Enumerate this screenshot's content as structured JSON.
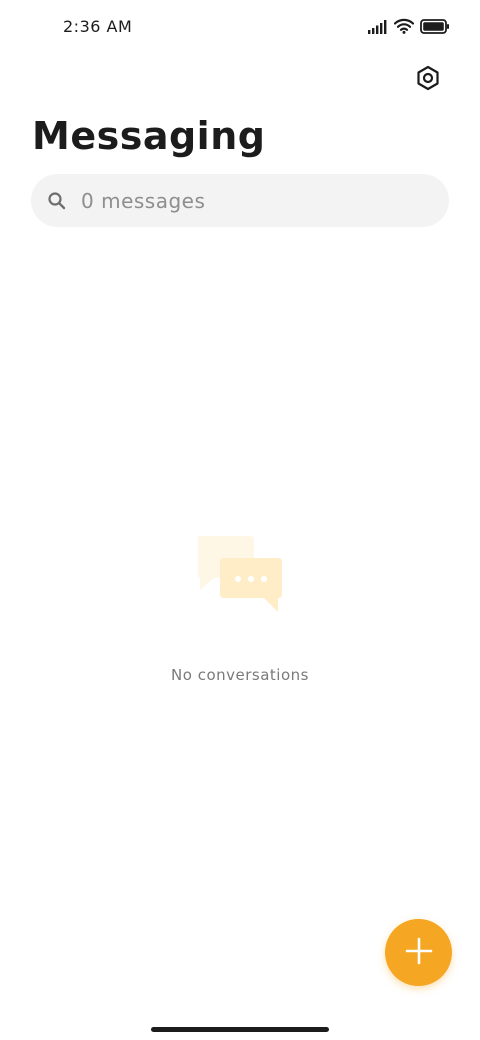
{
  "status_bar": {
    "time": "2:36 AM",
    "icons": [
      "signal-icon",
      "wifi-icon",
      "battery-icon"
    ]
  },
  "header": {
    "settings_icon": "settings-icon",
    "title": "Messaging"
  },
  "search": {
    "icon": "search-icon",
    "placeholder": "0 messages"
  },
  "empty_state": {
    "icon": "chat-bubbles-icon",
    "text": "No conversations"
  },
  "fab": {
    "icon": "plus-icon"
  },
  "colors": {
    "accent": "#f5a623",
    "illustration_light": "#fff7e6",
    "illustration_mid": "#ffedc7",
    "text_primary": "#1c1c1c",
    "text_secondary": "#7a7a7a",
    "search_bg": "#f3f3f3"
  }
}
